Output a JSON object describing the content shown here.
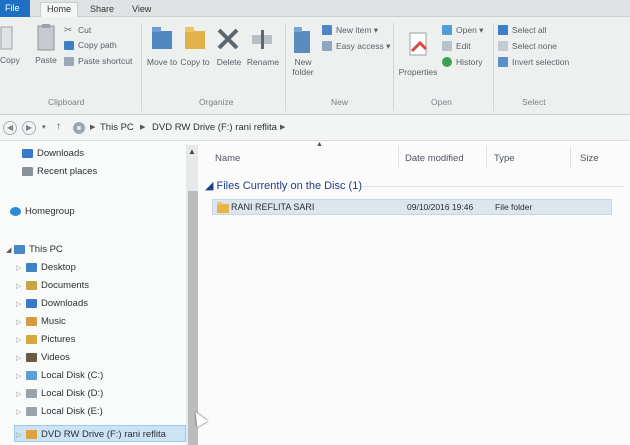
{
  "tabs": {
    "file": "File",
    "home": "Home",
    "share": "Share",
    "view": "View"
  },
  "ribbon": {
    "clipboard": {
      "copy": "Copy",
      "paste": "Paste",
      "cut": "Cut",
      "copy_path": "Copy path",
      "paste_shortcut": "Paste shortcut",
      "label": "Clipboard"
    },
    "organize": {
      "move_to": "Move to",
      "copy_to": "Copy to",
      "delete": "Delete",
      "rename": "Rename",
      "label": "Organize"
    },
    "new": {
      "new_folder": "New folder",
      "new_item": "New item",
      "easy_access": "Easy access",
      "label": "New"
    },
    "open": {
      "properties": "Properties",
      "open": "Open",
      "edit": "Edit",
      "history": "History",
      "label": "Open"
    },
    "select": {
      "select_all": "Select all",
      "select_none": "Select none",
      "invert_selection": "Invert selection",
      "label": "Select"
    }
  },
  "address": {
    "crumbs": [
      "This PC",
      "DVD RW Drive (F:) rani reflita"
    ]
  },
  "nav": {
    "items": [
      {
        "label": "Downloads",
        "color": "#3a78c9"
      },
      {
        "label": "Recent places",
        "color": "#8a9099"
      },
      {
        "label": "Homegroup",
        "color": "#2f8ad8"
      },
      {
        "label": "This PC",
        "color": "#4a87c7"
      },
      {
        "label": "Desktop",
        "color": "#3e82c8"
      },
      {
        "label": "Documents",
        "color": "#c9a24a"
      },
      {
        "label": "Downloads",
        "color": "#3a78c9"
      },
      {
        "label": "Music",
        "color": "#d69b3a"
      },
      {
        "label": "Pictures",
        "color": "#d5a83d"
      },
      {
        "label": "Videos",
        "color": "#6b5b45"
      },
      {
        "label": "Local Disk (C:)",
        "color": "#5aa0d8"
      },
      {
        "label": "Local Disk (D:)",
        "color": "#9aa3ab"
      },
      {
        "label": "Local Disk (E:)",
        "color": "#9aa3ab"
      },
      {
        "label": "DVD RW Drive (F:) rani reflita",
        "color": "#e0a33a"
      }
    ]
  },
  "columns": {
    "name": "Name",
    "date": "Date modified",
    "type": "Type",
    "size": "Size"
  },
  "group": {
    "title": "Files Currently on the Disc (1)"
  },
  "rows": [
    {
      "name": "RANI REFLITA SARI",
      "date": "09/10/2016 19:46",
      "type": "File folder"
    }
  ],
  "colors": {
    "file_tab": "#1f6fc3",
    "group_text": "#1d3f86",
    "selection": "#cce3f5",
    "folder": "#e5b443"
  }
}
